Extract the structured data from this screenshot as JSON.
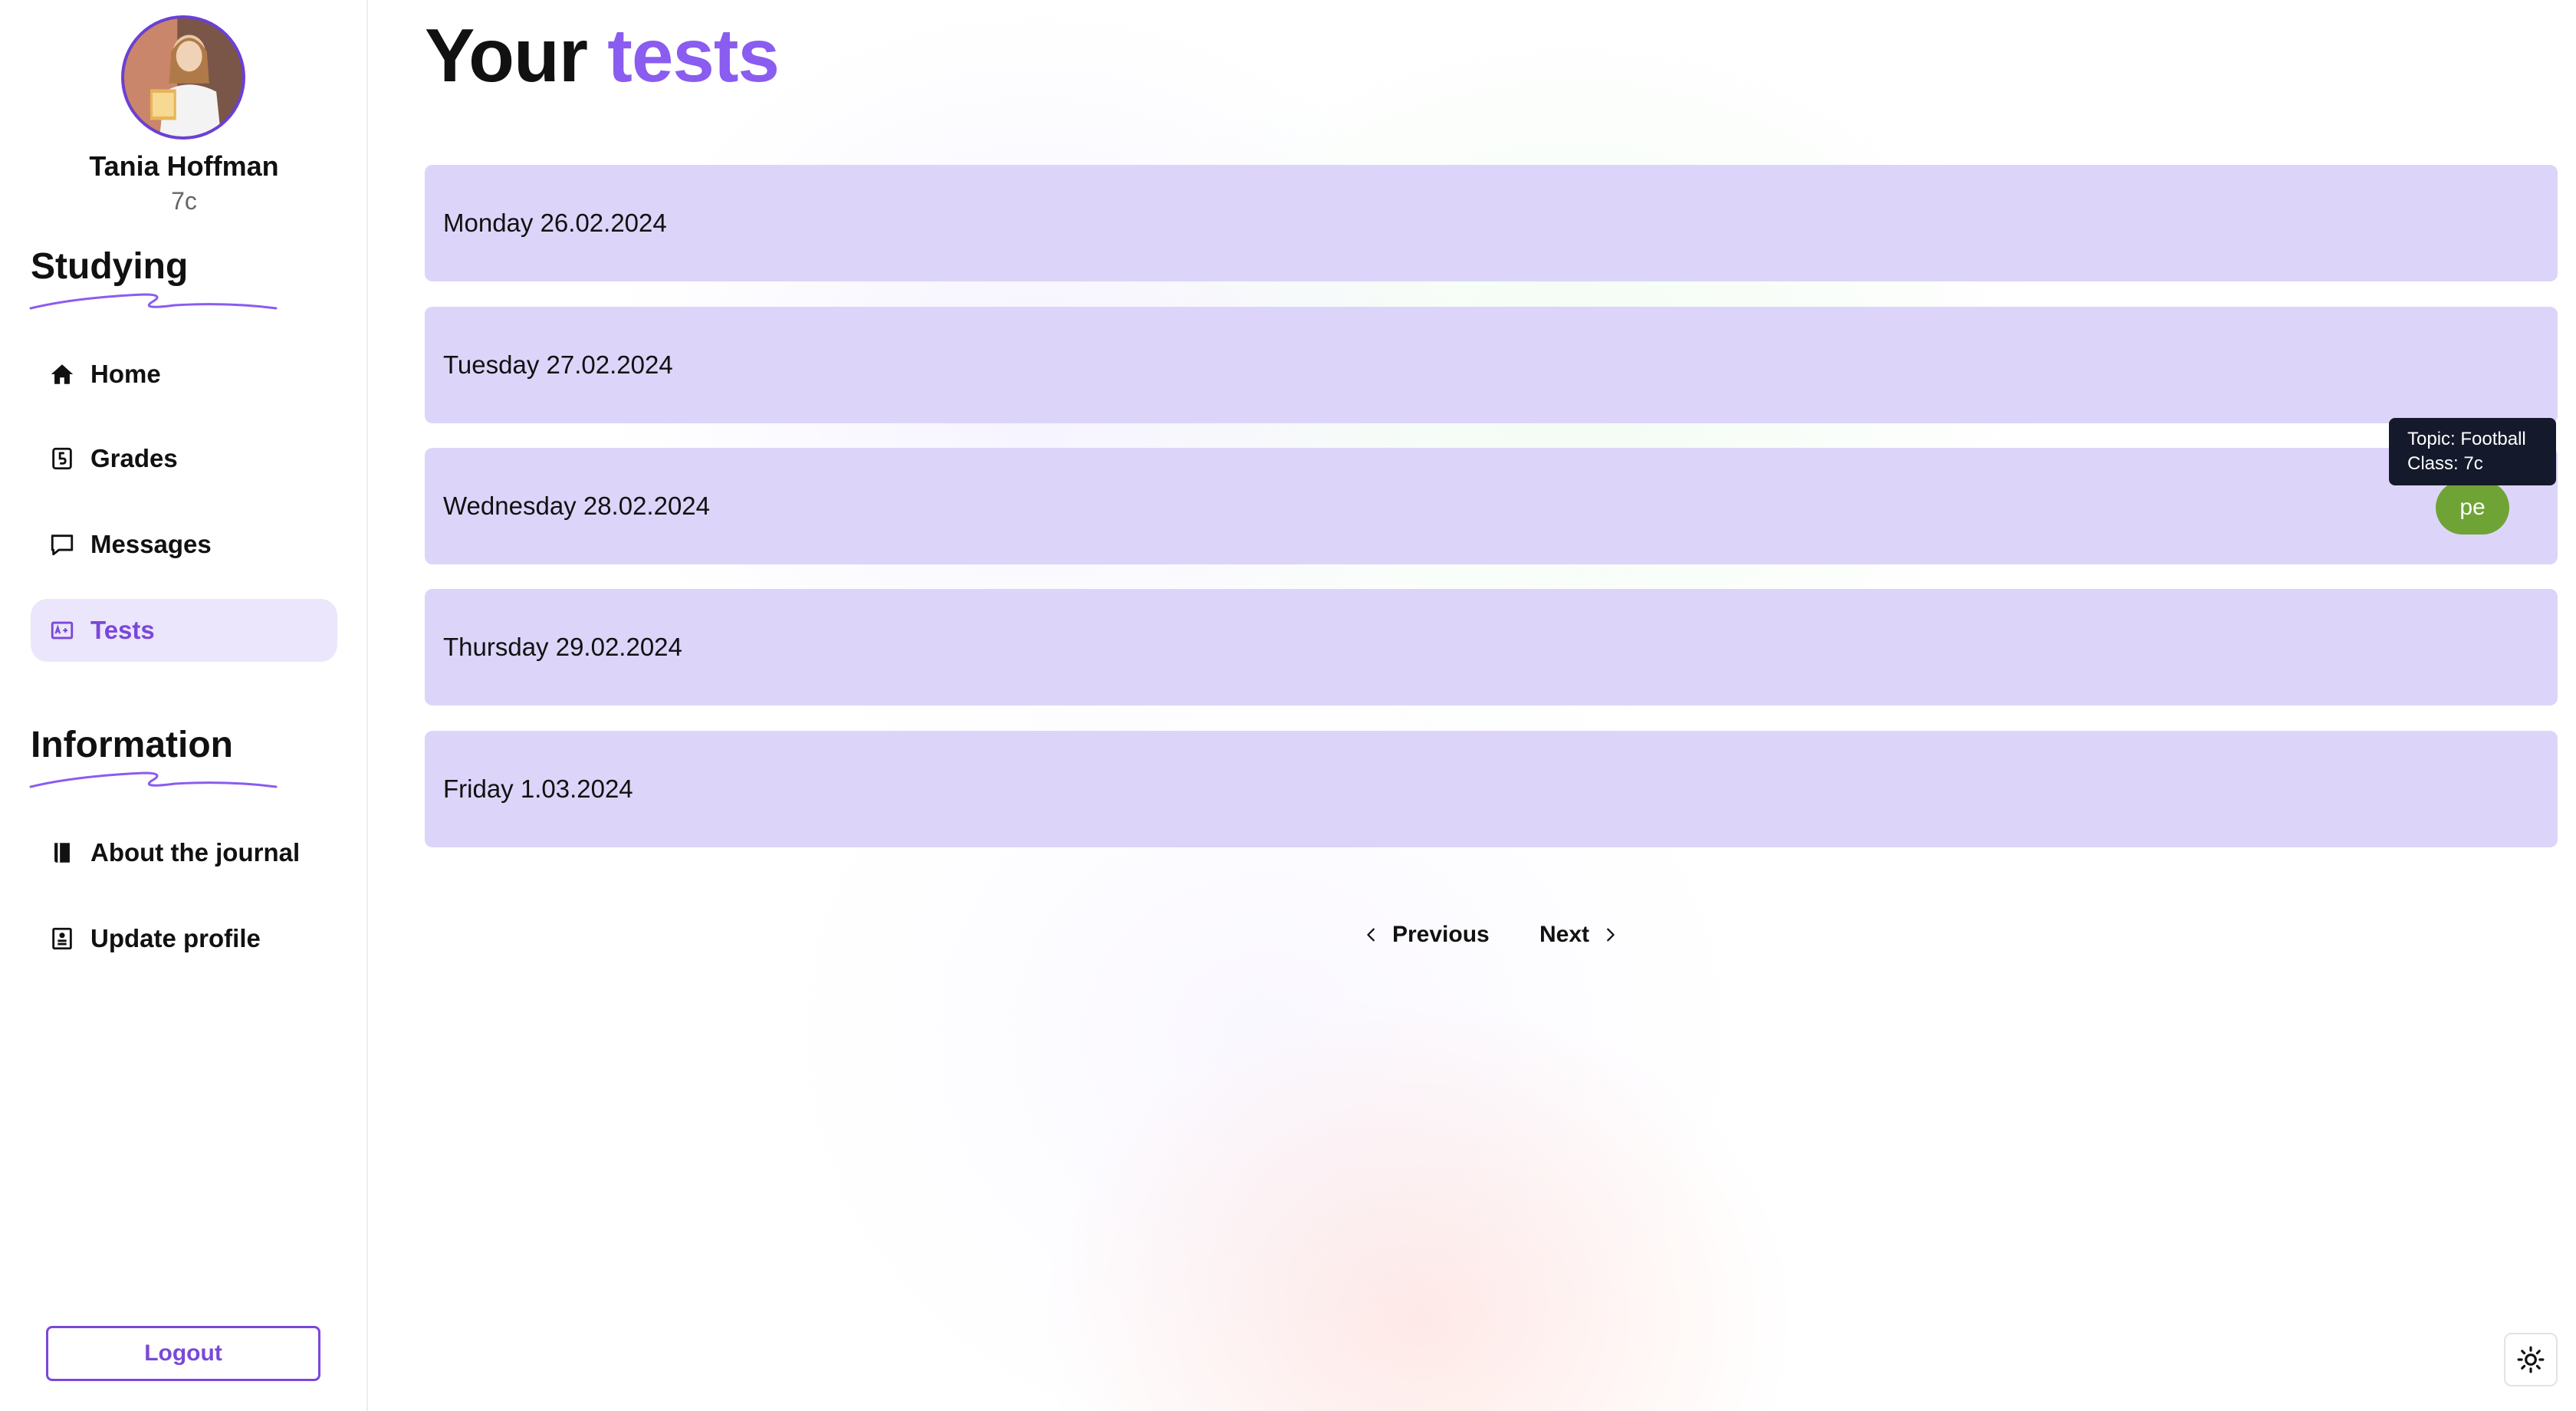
{
  "user": {
    "name": "Tania Hoffman",
    "class": "7c"
  },
  "sidebar": {
    "sections": [
      {
        "title": "Studying",
        "items": [
          {
            "label": "Home",
            "icon": "home-icon",
            "active": false
          },
          {
            "label": "Grades",
            "icon": "grade-icon",
            "active": false
          },
          {
            "label": "Messages",
            "icon": "message-icon",
            "active": false
          },
          {
            "label": "Tests",
            "icon": "tests-icon",
            "active": true
          }
        ]
      },
      {
        "title": "Information",
        "items": [
          {
            "label": "About the journal",
            "icon": "book-icon",
            "active": false
          },
          {
            "label": "Update profile",
            "icon": "profile-icon",
            "active": false
          }
        ]
      }
    ],
    "logout_label": "Logout"
  },
  "main": {
    "title_prefix": "Your",
    "title_accent": "tests",
    "days": [
      {
        "label": "Monday 26.02.2024"
      },
      {
        "label": "Tuesday 27.02.2024"
      },
      {
        "label": "Wednesday 28.02.2024"
      },
      {
        "label": "Thursday 29.02.2024"
      },
      {
        "label": "Friday 1.03.2024"
      }
    ],
    "test_chip": {
      "label": "pe",
      "tooltip_topic": "Topic: Football",
      "tooltip_class": "Class: 7c"
    },
    "pagination": {
      "previous_label": "Previous",
      "next_label": "Next"
    }
  },
  "colors": {
    "accent": "#8a5cf0",
    "row_background": "#dcd5f9",
    "chip": "#6fa336",
    "tooltip": "#141a2b"
  }
}
